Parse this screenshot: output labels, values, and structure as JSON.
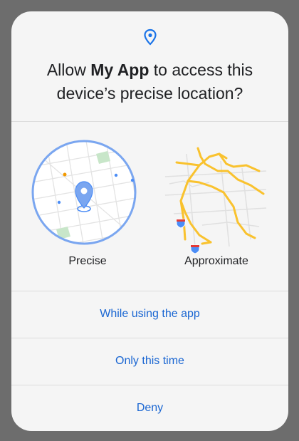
{
  "dialog": {
    "title_prefix": "Allow ",
    "app_name": "My App",
    "title_suffix": " to access this device’s precise location?",
    "icon": "location-pin-icon"
  },
  "options": {
    "precise_label": "Precise",
    "approximate_label": "Approximate"
  },
  "actions": {
    "while_using": "While using the app",
    "only_this_time": "Only this time",
    "deny": "Deny"
  },
  "colors": {
    "accent": "#1a73e8",
    "action_text": "#1a66d2",
    "map_roads": "#f9c22e",
    "background": "#f5f5f5"
  }
}
